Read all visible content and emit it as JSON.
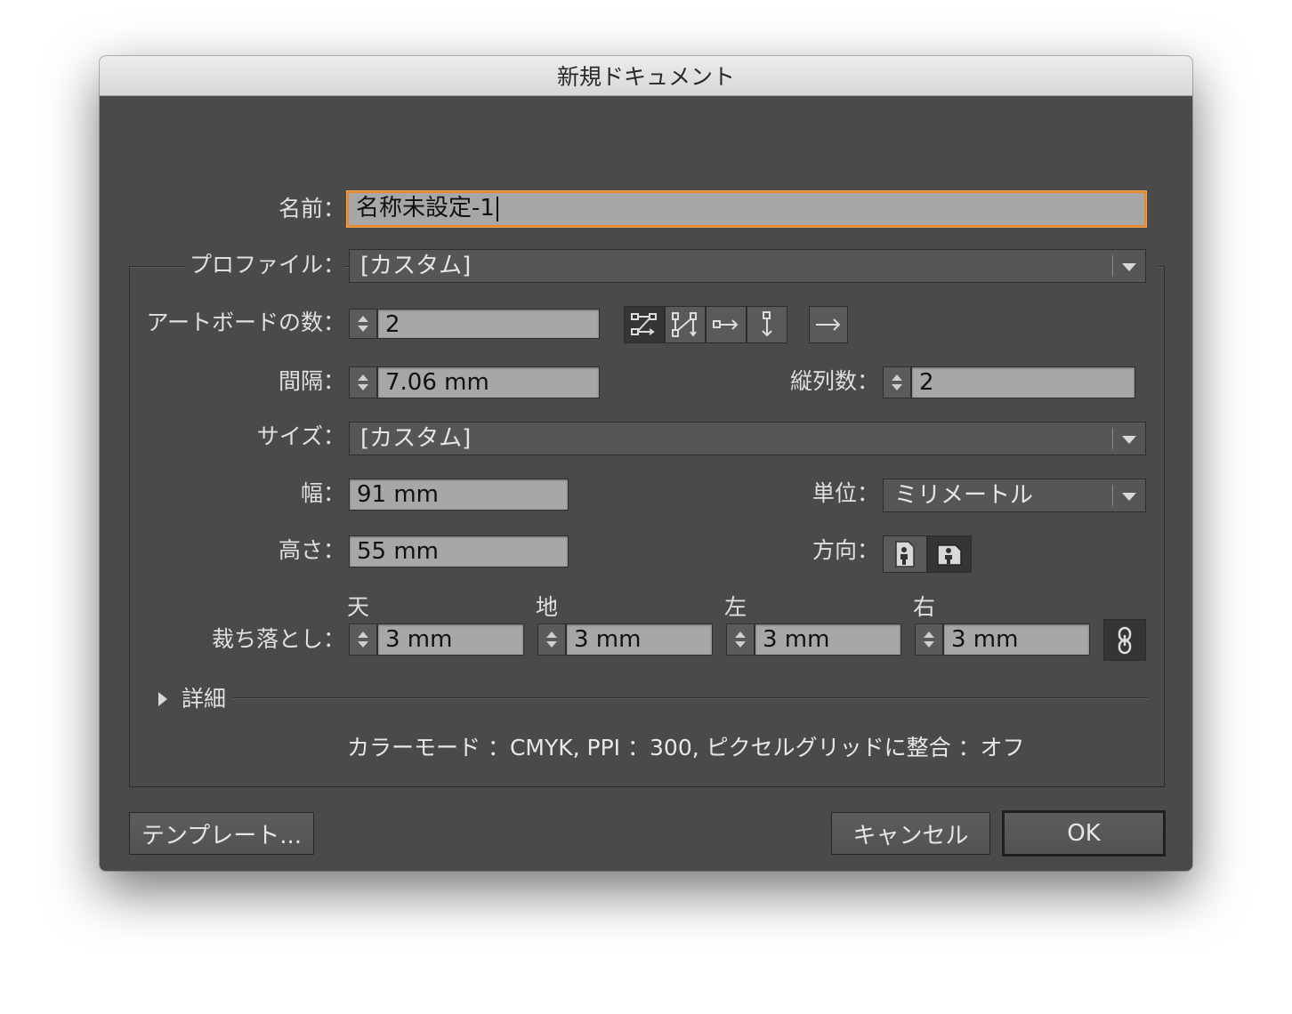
{
  "window": {
    "title": "新規ドキュメント"
  },
  "name": {
    "label": "名前：",
    "value": "名称未設定-1"
  },
  "profile": {
    "label": "プロファイル：",
    "value": "[カスタム]"
  },
  "artboards": {
    "label": "アートボードの数：",
    "value": "2"
  },
  "spacing": {
    "label": "間隔：",
    "value": "7.06 mm"
  },
  "columns": {
    "label": "縦列数：",
    "value": "2"
  },
  "size": {
    "label": "サイズ：",
    "value": "[カスタム]"
  },
  "width": {
    "label": "幅：",
    "value": "91 mm"
  },
  "units": {
    "label": "単位：",
    "value": "ミリメートル"
  },
  "height": {
    "label": "高さ：",
    "value": "55 mm"
  },
  "orientation": {
    "label": "方向："
  },
  "bleed": {
    "label": "裁ち落とし：",
    "top": {
      "label": "天",
      "value": "3 mm"
    },
    "bottom": {
      "label": "地",
      "value": "3 mm"
    },
    "left": {
      "label": "左",
      "value": "3 mm"
    },
    "right": {
      "label": "右",
      "value": "3 mm"
    }
  },
  "advanced": {
    "label": "詳細"
  },
  "summary": "カラーモード ：CMYK, PPI ：300, ピクセルグリッドに整合 ：オフ",
  "buttons": {
    "template": "テンプレート...",
    "cancel": "キャンセル",
    "ok": "OK"
  },
  "colors": {
    "dialog_bg": "#4a4a4a",
    "field_bg": "#a7a7a7",
    "focus_ring": "#e8892b"
  }
}
